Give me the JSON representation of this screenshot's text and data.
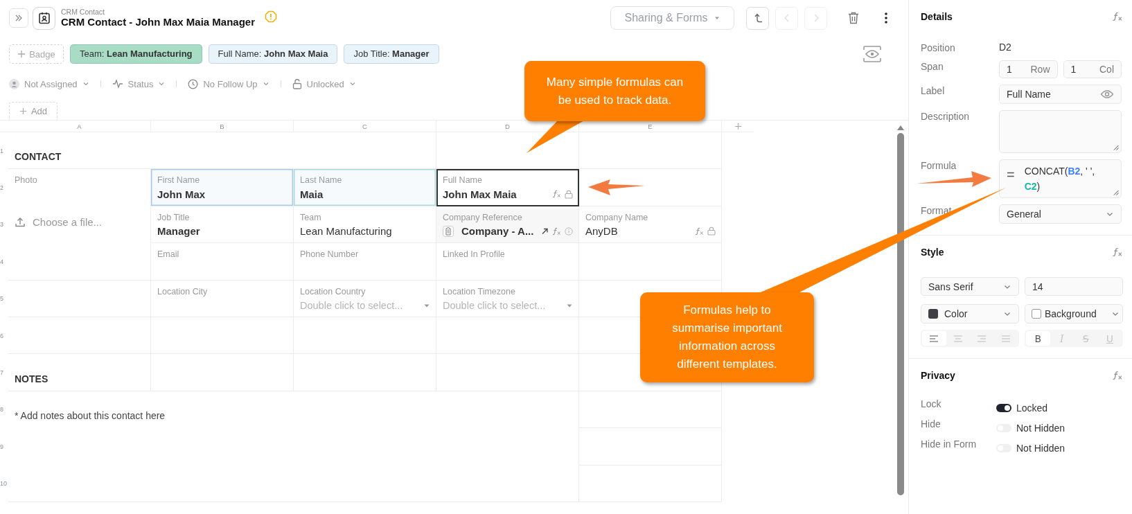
{
  "header": {
    "subtitle": "CRM Contact",
    "title": "CRM Contact - John Max Maia Manager",
    "sharing": "Sharing & Forms",
    "nav": [
      {
        "kind": "up",
        "disabled": false
      },
      {
        "kind": "prev",
        "disabled": true
      },
      {
        "kind": "next",
        "disabled": true
      }
    ]
  },
  "badges": {
    "add": "Badge",
    "items": [
      {
        "label": "Team:",
        "value": "Lean Manufacturing",
        "color": "#a8dcc5"
      },
      {
        "label": "Full Name:",
        "value": "John Max Maia",
        "color": "#e9f3fa"
      },
      {
        "label": "Job Title:",
        "value": "Manager",
        "color": "#e9f3fa"
      }
    ]
  },
  "meta": [
    {
      "kind": "assignee",
      "label": "Not Assigned"
    },
    {
      "kind": "status",
      "label": "Status"
    },
    {
      "kind": "follow_up",
      "label": "No Follow Up"
    },
    {
      "kind": "lock",
      "label": "Unlocked"
    }
  ],
  "add_button": "Add",
  "grid": {
    "columns": [
      "A",
      "B",
      "C",
      "D",
      "E"
    ],
    "rows": [
      "1",
      "2",
      "3",
      "4",
      "5",
      "6",
      "7",
      "8",
      "9",
      "10"
    ],
    "cells": [
      {
        "kind": "heading",
        "text": "CONTACT",
        "selected": false
      },
      {
        "kind": "photo",
        "label": "Photo",
        "action": "Choose a file...",
        "selected": false
      },
      {
        "kind": "field",
        "label": "First Name",
        "value": "John Max",
        "bold": true,
        "color": "#a9c9ee",
        "formula": false,
        "locked": false,
        "selected": false
      },
      {
        "kind": "field",
        "label": "Last Name",
        "value": "Maia",
        "bold": true,
        "color": "#a6ddd8",
        "formula": false,
        "locked": false,
        "selected": false
      },
      {
        "kind": "field",
        "label": "Full Name",
        "value": "John Max Maia",
        "bold": true,
        "formula": true,
        "locked": true,
        "selected": true
      },
      {
        "kind": "field",
        "label": "Job Title",
        "value": "Manager",
        "bold": true,
        "formula": false,
        "locked": false,
        "selected": false
      },
      {
        "kind": "field",
        "label": "Team",
        "value": "Lean Manufacturing",
        "bold": false,
        "formula": false,
        "locked": false,
        "selected": false
      },
      {
        "kind": "reference",
        "label": "Company Reference",
        "value": "Company - A...",
        "formula": true,
        "info": true,
        "selected": false
      },
      {
        "kind": "field",
        "label": "Company Name",
        "value": "AnyDB",
        "bold": false,
        "formula": true,
        "locked": true,
        "selected": false
      },
      {
        "kind": "field",
        "label": "Email",
        "formula": false,
        "locked": false,
        "selected": false
      },
      {
        "kind": "field",
        "label": "Phone Number",
        "formula": false,
        "locked": false,
        "selected": false
      },
      {
        "kind": "field",
        "label": "Linked In Profile",
        "formula": false,
        "locked": false,
        "selected": false
      },
      {
        "kind": "field",
        "label": "Location City",
        "formula": false,
        "locked": false,
        "selected": false
      },
      {
        "kind": "select",
        "label": "Location Country",
        "placeholder": "Double click to select...",
        "selected": false
      },
      {
        "kind": "select",
        "label": "Location Timezone",
        "placeholder": "Double click to select...",
        "selected": false
      },
      {
        "kind": "heading",
        "text": "NOTES",
        "selected": false
      },
      {
        "kind": "notes",
        "text": "* Add notes about this contact here",
        "selected": false
      }
    ]
  },
  "callouts": [
    {
      "text": "Many simple formulas can be used to track data."
    },
    {
      "text": "Formulas help to summarise important information across different templates."
    }
  ],
  "panel": {
    "details": {
      "title": "Details",
      "rows": [
        {
          "kind": "text",
          "label": "Position",
          "value": "D2"
        },
        {
          "kind": "span",
          "label": "Span",
          "inputs": [
            {
              "value": "1",
              "unit": "Row"
            },
            {
              "value": "1",
              "unit": "Col"
            }
          ]
        },
        {
          "kind": "input",
          "label": "Label",
          "value": "Full Name"
        },
        {
          "kind": "textarea",
          "label": "Description"
        },
        {
          "kind": "formula",
          "label": "Formula",
          "prefix": "=",
          "parts": [
            {
              "text": "CONCAT("
            },
            {
              "text": "B2",
              "color": "#3b82f6"
            },
            {
              "text": ", ' ', "
            },
            {
              "text": "C2",
              "color": "#14b8a6"
            },
            {
              "text": ")"
            }
          ]
        },
        {
          "kind": "select",
          "label": "Format",
          "value": "General"
        }
      ]
    },
    "style": {
      "title": "Style",
      "font": "Sans Serif",
      "size": "14",
      "color": {
        "label": "Color",
        "color": "#3f3f46"
      },
      "background": {
        "label": "Background",
        "color": "#ffffff"
      },
      "align": [
        {
          "kind": "left",
          "selected": true
        },
        {
          "kind": "center",
          "selected": false
        },
        {
          "kind": "right",
          "selected": false
        },
        {
          "kind": "justify",
          "selected": false
        }
      ],
      "format": [
        {
          "kind": "bold",
          "text": "B",
          "selected": true
        },
        {
          "kind": "italic",
          "text": "I",
          "selected": false
        },
        {
          "kind": "strike",
          "text": "S",
          "selected": false
        },
        {
          "kind": "underline",
          "text": "U",
          "selected": false
        }
      ]
    },
    "privacy": {
      "title": "Privacy",
      "rows": [
        {
          "label": "Lock",
          "on": true,
          "value": "Locked"
        },
        {
          "label": "Hide",
          "on": false,
          "value": "Not Hidden"
        },
        {
          "label": "Hide in Form",
          "on": false,
          "value": "Not Hidden"
        }
      ]
    }
  }
}
